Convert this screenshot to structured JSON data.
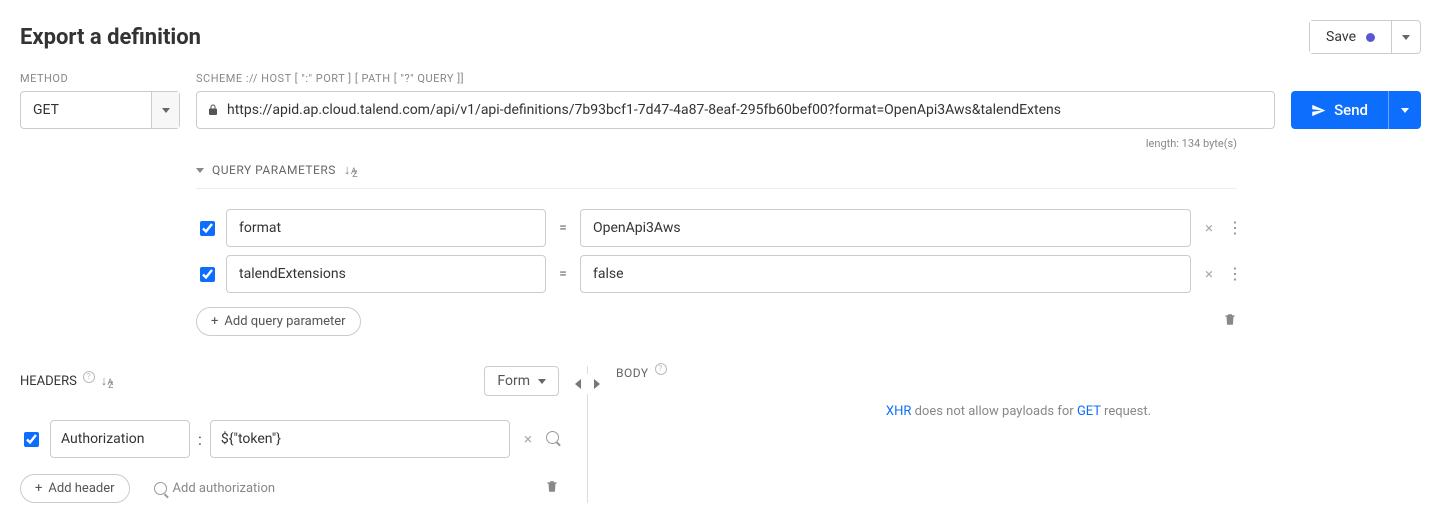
{
  "title": "Export a definition",
  "save": {
    "label": "Save"
  },
  "labels": {
    "method": "METHOD",
    "scheme": "SCHEME :// HOST [ \":\" PORT ] [ PATH [ \"?\" QUERY ]]"
  },
  "method": "GET",
  "url": "https://apid.ap.cloud.talend.com/api/v1/api-definitions/7b93bcf1-7d47-4a87-8eaf-295fb60bef00?format=OpenApi3Aws&talendExtens",
  "length": "length: 134 byte(s)",
  "send": {
    "label": "Send"
  },
  "qp": {
    "title": "QUERY PARAMETERS",
    "rows": [
      {
        "enabled": true,
        "name": "format",
        "value": "OpenApi3Aws"
      },
      {
        "enabled": true,
        "name": "talendExtensions",
        "value": "false"
      }
    ],
    "add": "Add query parameter"
  },
  "headers": {
    "title": "HEADERS",
    "mode": "Form",
    "rows": [
      {
        "enabled": true,
        "name": "Authorization",
        "value": "${\"token\"}"
      }
    ],
    "add": "Add header",
    "addAuth": "Add authorization"
  },
  "body": {
    "title": "BODY",
    "xhr": "XHR",
    "mid": " does not allow payloads for ",
    "get": "GET",
    "tail": " request."
  }
}
